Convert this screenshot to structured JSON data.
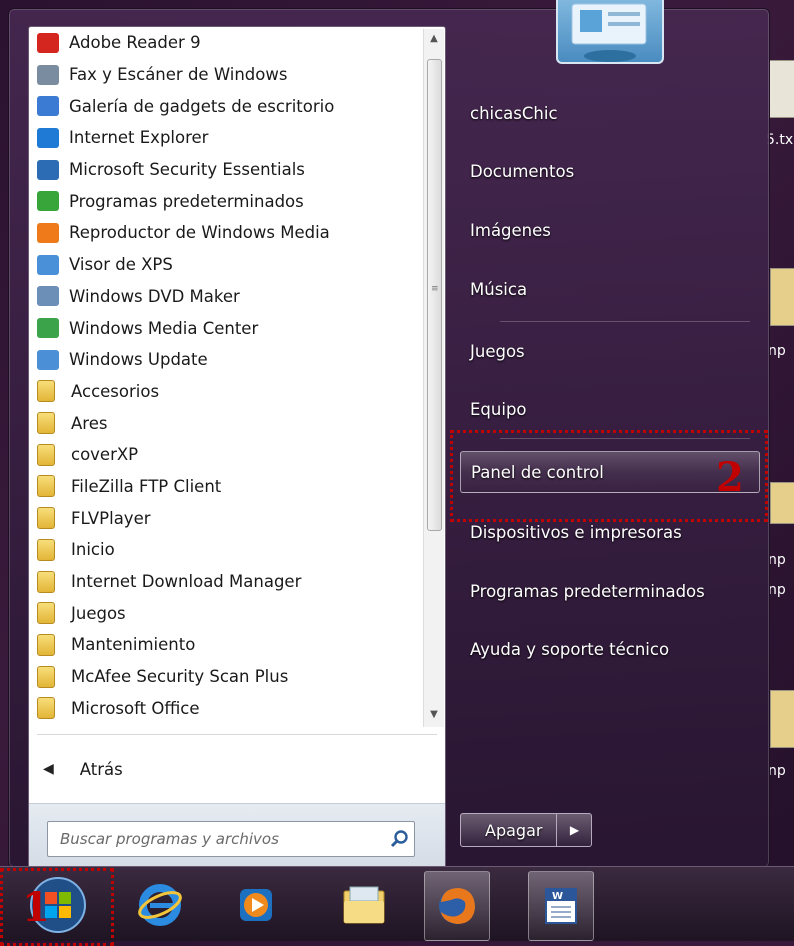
{
  "menu": {
    "programs": [
      {
        "label": "Adobe Reader 9",
        "icon": "adobe-reader-icon",
        "color": "#d5251f"
      },
      {
        "label": "Fax y Escáner de Windows",
        "icon": "fax-scanner-icon",
        "color": "#7a8da0"
      },
      {
        "label": "Galería de gadgets de escritorio",
        "icon": "gadget-gallery-icon",
        "color": "#3b7bd4"
      },
      {
        "label": "Internet Explorer",
        "icon": "internet-explorer-icon",
        "color": "#1f7ad6"
      },
      {
        "label": "Microsoft Security Essentials",
        "icon": "security-essentials-icon",
        "color": "#2b6cb5"
      },
      {
        "label": "Programas predeterminados",
        "icon": "default-programs-icon",
        "color": "#38a53a"
      },
      {
        "label": "Reproductor de Windows Media",
        "icon": "media-player-icon",
        "color": "#ef7a1a"
      },
      {
        "label": "Visor de XPS",
        "icon": "xps-viewer-icon",
        "color": "#4a90d9"
      },
      {
        "label": "Windows DVD Maker",
        "icon": "dvd-maker-icon",
        "color": "#6c8fb8"
      },
      {
        "label": "Windows Media Center",
        "icon": "media-center-icon",
        "color": "#3ba34a"
      },
      {
        "label": "Windows Update",
        "icon": "windows-update-icon",
        "color": "#4b8fd6"
      },
      {
        "label": "Accesorios",
        "icon": "folder-icon"
      },
      {
        "label": "Ares",
        "icon": "folder-icon"
      },
      {
        "label": "coverXP",
        "icon": "folder-icon"
      },
      {
        "label": "FileZilla FTP Client",
        "icon": "folder-icon"
      },
      {
        "label": "FLVPlayer",
        "icon": "folder-icon"
      },
      {
        "label": "Inicio",
        "icon": "folder-icon"
      },
      {
        "label": "Internet Download Manager",
        "icon": "folder-icon"
      },
      {
        "label": "Juegos",
        "icon": "folder-icon"
      },
      {
        "label": "Mantenimiento",
        "icon": "folder-icon"
      },
      {
        "label": "McAfee Security Scan Plus",
        "icon": "folder-icon"
      },
      {
        "label": "Microsoft Office",
        "icon": "folder-icon"
      }
    ],
    "back_label": "Atrás",
    "search_placeholder": "Buscar programas y archivos",
    "right_items": [
      {
        "label": "chicasChic",
        "name": "user-folder"
      },
      {
        "label": "Documentos",
        "name": "documents"
      },
      {
        "label": "Imágenes",
        "name": "pictures"
      },
      {
        "label": "Música",
        "name": "music"
      },
      {
        "label": "Juegos",
        "name": "games"
      },
      {
        "label": "Equipo",
        "name": "computer"
      },
      {
        "label": "Panel de control",
        "name": "control-panel"
      },
      {
        "label": "Dispositivos e impresoras",
        "name": "devices-printers"
      },
      {
        "label": "Programas predeterminados",
        "name": "default-programs"
      },
      {
        "label": "Ayuda y soporte técnico",
        "name": "help-support"
      }
    ],
    "shutdown_label": "Apagar"
  },
  "desktop": {
    "fragments": [
      "5.tx",
      "np",
      "np",
      "np",
      "np"
    ]
  },
  "annotations": {
    "step1": "1",
    "step2": "2"
  },
  "taskbar": {
    "items": [
      "start-orb",
      "internet-explorer",
      "media-player",
      "explorer",
      "firefox",
      "word"
    ]
  }
}
